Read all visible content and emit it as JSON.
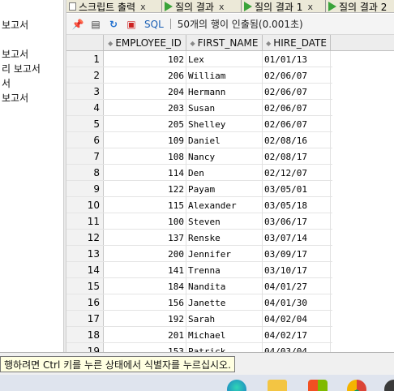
{
  "left_panel": {
    "items": [
      "보고서",
      "보고서",
      "리 보고서",
      "서",
      "보고서"
    ]
  },
  "tabs": [
    {
      "label": "스크립트 출력",
      "close": "x",
      "icon": "script-icon"
    },
    {
      "label": "질의 결과",
      "close": "x",
      "icon": "run-icon"
    },
    {
      "label": "질의 결과 1",
      "close": "x",
      "icon": "run-icon"
    },
    {
      "label": "질의 결과 2",
      "close": "",
      "icon": "run-icon"
    }
  ],
  "toolbar": {
    "sql_label": "SQL",
    "status": "50개의 행이 인출됨(0.001초)"
  },
  "grid": {
    "columns": [
      "EMPLOYEE_ID",
      "FIRST_NAME",
      "HIRE_DATE"
    ],
    "rows": [
      {
        "num": "1",
        "id": "102",
        "name": "Lex",
        "date": "01/01/13"
      },
      {
        "num": "2",
        "id": "206",
        "name": "William",
        "date": "02/06/07"
      },
      {
        "num": "3",
        "id": "204",
        "name": "Hermann",
        "date": "02/06/07"
      },
      {
        "num": "4",
        "id": "203",
        "name": "Susan",
        "date": "02/06/07"
      },
      {
        "num": "5",
        "id": "205",
        "name": "Shelley",
        "date": "02/06/07"
      },
      {
        "num": "6",
        "id": "109",
        "name": "Daniel",
        "date": "02/08/16"
      },
      {
        "num": "7",
        "id": "108",
        "name": "Nancy",
        "date": "02/08/17"
      },
      {
        "num": "8",
        "id": "114",
        "name": "Den",
        "date": "02/12/07"
      },
      {
        "num": "9",
        "id": "122",
        "name": "Payam",
        "date": "03/05/01"
      },
      {
        "num": "10",
        "id": "115",
        "name": "Alexander",
        "date": "03/05/18"
      },
      {
        "num": "11",
        "id": "100",
        "name": "Steven",
        "date": "03/06/17"
      },
      {
        "num": "12",
        "id": "137",
        "name": "Renske",
        "date": "03/07/14"
      },
      {
        "num": "13",
        "id": "200",
        "name": "Jennifer",
        "date": "03/09/17"
      },
      {
        "num": "14",
        "id": "141",
        "name": "Trenna",
        "date": "03/10/17"
      },
      {
        "num": "15",
        "id": "184",
        "name": "Nandita",
        "date": "04/01/27"
      },
      {
        "num": "16",
        "id": "156",
        "name": "Janette",
        "date": "04/01/30"
      },
      {
        "num": "17",
        "id": "192",
        "name": "Sarah",
        "date": "04/02/04"
      },
      {
        "num": "18",
        "id": "201",
        "name": "Michael",
        "date": "04/02/17"
      },
      {
        "num": "19",
        "id": "153",
        "name": "Patrick",
        "date": "04/03/04"
      }
    ]
  },
  "status_bar": {
    "tip": "행하려면 Ctrl 키를 누른 상태에서 식별자를 누르십시오."
  }
}
